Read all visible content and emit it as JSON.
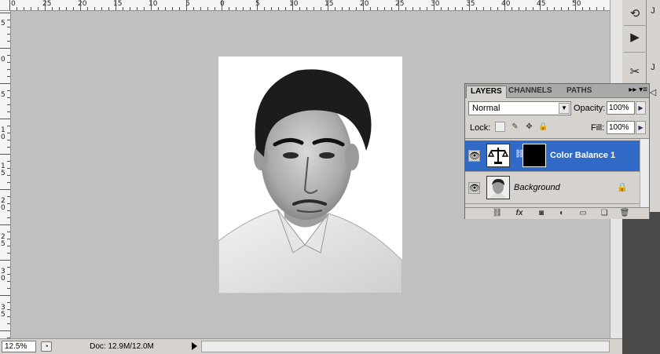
{
  "ruler_top": {
    "labels": [
      "0",
      "25",
      "20",
      "15",
      "10",
      "5",
      "0",
      "5",
      "10",
      "15",
      "20",
      "25",
      "30",
      "35",
      "40",
      "45",
      "50"
    ]
  },
  "ruler_left": {
    "labels": [
      "5",
      "0",
      "5",
      "1 0",
      "1 5",
      "2 0",
      "2 5",
      "3 0",
      "3 5"
    ]
  },
  "status": {
    "zoom": "12.5%",
    "doc_info": "Doc: 12.9M/12.0M"
  },
  "layers_panel": {
    "tabs": [
      "LAYERS",
      "CHANNELS",
      "PATHS"
    ],
    "menu_glyph": "▸▸ ▾≡",
    "blend_mode": "Normal",
    "opacity_label": "Opacity:",
    "opacity_value": "100%",
    "lock_label": "Lock:",
    "fill_label": "Fill:",
    "fill_value": "100%",
    "layers": [
      {
        "name": "Color Balance 1",
        "selected": true
      },
      {
        "name": "Background",
        "selected": false
      }
    ]
  },
  "icons": {
    "eye": "👁",
    "lock": "🔒",
    "chain": "⛓",
    "fx": "fx",
    "mask": "◙",
    "adjust": "◐",
    "folder": "▭",
    "new": "❏",
    "trash": "🗑"
  },
  "colors": {
    "selection": "#3169c6",
    "canvas": "#c0c0c0",
    "panel": "#d6d3ce"
  }
}
